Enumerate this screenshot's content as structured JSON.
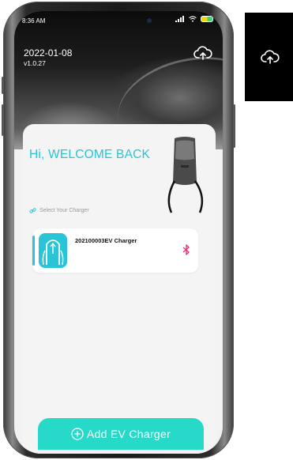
{
  "status_bar": {
    "time": "8:36 AM"
  },
  "header": {
    "date": "2022-01-08",
    "version": "v1.0.27",
    "cloud_icon": "cloud-upload-icon"
  },
  "main": {
    "welcome": "Hi, WELCOME BACK",
    "select_label": "Select Your Charger",
    "chargers": [
      {
        "name": "202100003EV Charger",
        "icon": "ev-charger-icon",
        "status_icon": "bluetooth-icon"
      }
    ]
  },
  "footer": {
    "add_label": "Add EV Charger"
  },
  "side_preview": {
    "icon": "cloud-upload-icon"
  },
  "colors": {
    "accent": "#29c4d6",
    "button": "#27d9c8",
    "bluetooth": "#e8336d"
  }
}
